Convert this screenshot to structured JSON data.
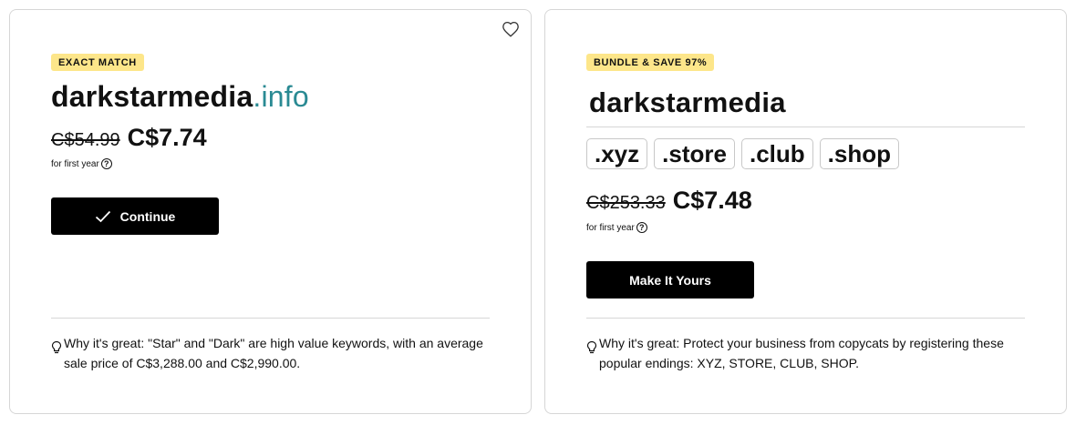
{
  "left_card": {
    "badge": "EXACT MATCH",
    "domain_name": "darkstarmedia",
    "domain_tld": ".info",
    "old_price": "C$54.99",
    "new_price": "C$7.74",
    "first_year": "for first year",
    "button_label": "Continue",
    "why_text": "Why it's great: \"Star\" and \"Dark\" are high value keywords, with an average sale price of C$3,288.00 and C$2,990.00."
  },
  "right_card": {
    "badge": "BUNDLE & SAVE 97%",
    "domain_name": "darkstarmedia",
    "tlds": [
      ".xyz",
      ".store",
      ".club",
      ".shop"
    ],
    "old_price": "C$253.33",
    "new_price": "C$7.48",
    "first_year": "for first year",
    "button_label": "Make It Yours",
    "why_text": "Why it's great: Protect your business from copycats by registering these popular endings: XYZ, STORE, CLUB, SHOP."
  },
  "icons": {
    "favorite": "heart-icon",
    "info": "question-circle-icon",
    "tip": "lightbulb-icon",
    "confirm": "check-icon"
  },
  "colors": {
    "badge_bg": "#fde68a",
    "tld_accent": "#2a8a93",
    "button_bg": "#000000"
  }
}
